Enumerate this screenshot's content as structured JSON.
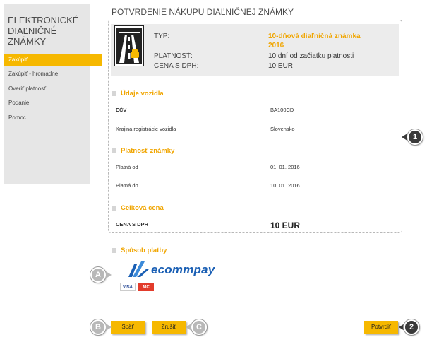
{
  "sidebar": {
    "title": "Elektronické diaľničné známky",
    "items": [
      {
        "label": "Zakúpiť"
      },
      {
        "label": "Zakúpiť - hromadne"
      },
      {
        "label": "Overiť platnosť"
      },
      {
        "label": "Podanie"
      },
      {
        "label": "Pomoc"
      }
    ]
  },
  "page": {
    "title": "Potvrdenie nákupu diaľničnej známky"
  },
  "summary": {
    "type_label": "TYP:",
    "type_value_line1": "10-dňová diaľničná známka",
    "type_value_line2": "2016",
    "validity_label": "PLATNOSŤ:",
    "validity_value": "10 dní od začiatku platnosti",
    "price_label": "CENA S DPH:",
    "price_value": "10 EUR"
  },
  "vehicle": {
    "section_title": "Údaje vozidla",
    "ecv_label": "EČV",
    "ecv_value": "BA100CD",
    "country_label": "Krajina registrácie vozidla",
    "country_value": "Slovensko"
  },
  "validity": {
    "section_title": "Platnosť známky",
    "from_label": "Platná od",
    "from_value": "01. 01. 2016",
    "to_label": "Platná do",
    "to_value": "10. 01. 2016"
  },
  "total": {
    "section_title": "Celková cena",
    "label": "CENA S DPH",
    "value": "10 EUR"
  },
  "payment": {
    "section_title": "Spôsob platby",
    "provider": "ecommpay",
    "cards": [
      "VISA",
      "MC"
    ]
  },
  "buttons": {
    "back": "Späť",
    "cancel": "Zrušiť",
    "confirm": "Potvrdiť"
  },
  "markers": {
    "m1": "1",
    "m2": "2",
    "mA": "A",
    "mB": "B",
    "mC": "C"
  },
  "colors": {
    "accent": "#f6b800",
    "section": "#f0a500",
    "brand": "#1a5fb4"
  }
}
